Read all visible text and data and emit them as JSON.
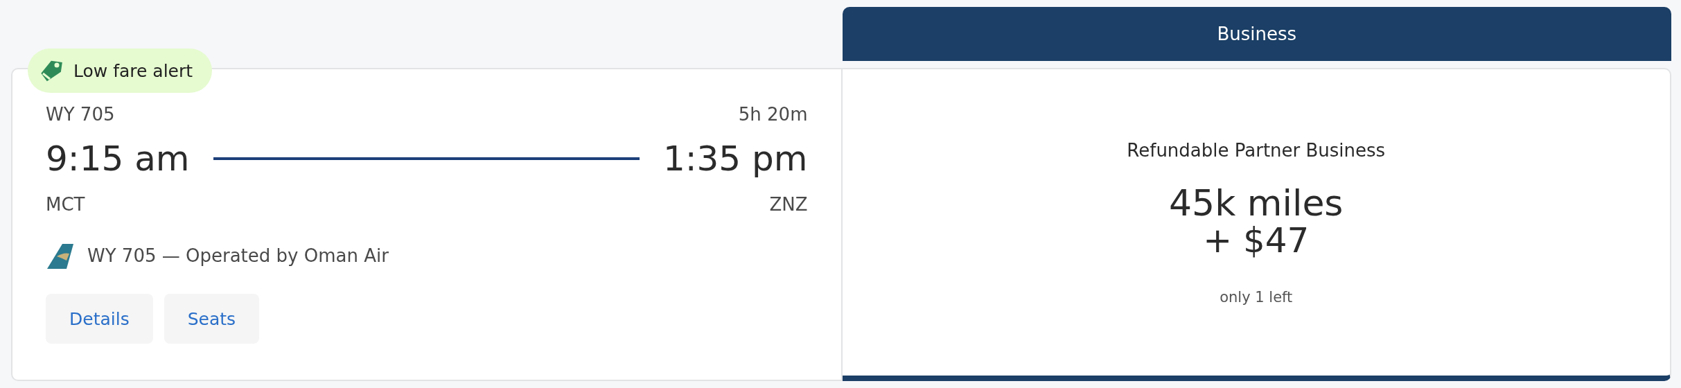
{
  "flight": {
    "badge": {
      "label": "Low fare alert"
    },
    "flight_number": "WY 705",
    "duration": "5h 20m",
    "depart_time": "9:15 am",
    "arrive_time": "1:35 pm",
    "origin": "MCT",
    "destination": "ZNZ",
    "operated_by": "WY 705 — Operated by Oman Air",
    "buttons": [
      "Details",
      "Seats"
    ]
  },
  "fare": {
    "cabin": "Business",
    "name": "Refundable Partner Business",
    "miles": "45k miles",
    "cash": "+ $47",
    "availability": "only 1 left"
  }
}
